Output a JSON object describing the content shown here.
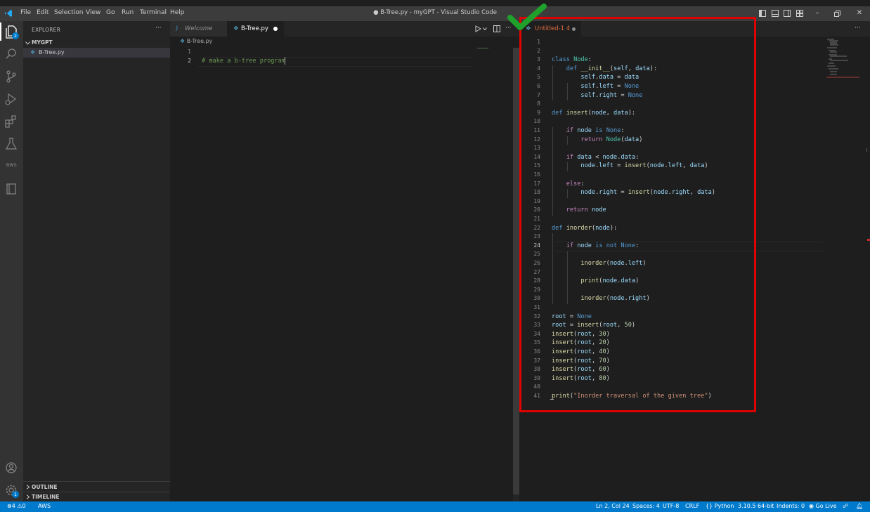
{
  "titlebar": {
    "menus": [
      "File",
      "Edit",
      "Selection",
      "View",
      "Go",
      "Run",
      "Terminal",
      "Help"
    ],
    "window_title": "● B-Tree.py - myGPT - Visual Studio Code"
  },
  "activitybar": {
    "explorer_badge": "2",
    "settings_badge": "1",
    "aws_label": "aws"
  },
  "sidebar": {
    "header": "EXPLORER",
    "more": "···",
    "folder": "MYGPT",
    "file": "B-Tree.py",
    "outline": "OUTLINE",
    "timeline": "TIMELINE"
  },
  "left_editor": {
    "tabs": [
      {
        "label": "Welcome"
      },
      {
        "label": "B-Tree.py"
      }
    ],
    "breadcrumb": "B-Tree.py",
    "lines": [
      "",
      "# make a b-tree program"
    ],
    "line_numbers": [
      "1",
      "2"
    ]
  },
  "right_editor": {
    "tab_label": "Untitled-1 4",
    "more": "···",
    "line_numbers": [
      "1",
      "2",
      "3",
      "4",
      "5",
      "6",
      "7",
      "8",
      "9",
      "10",
      "11",
      "12",
      "13",
      "14",
      "15",
      "16",
      "17",
      "18",
      "19",
      "20",
      "21",
      "22",
      "23",
      "24",
      "25",
      "26",
      "27",
      "28",
      "29",
      "30",
      "31",
      "32",
      "33",
      "34",
      "35",
      "36",
      "37",
      "38",
      "39",
      "40",
      "41"
    ],
    "lines": [
      "",
      "",
      "class Node:",
      "    def __init__(self, data):",
      "        self.data = data",
      "        self.left = None",
      "        self.right = None",
      "",
      "def insert(node, data):",
      "",
      "    if node is None:",
      "        return Node(data)",
      "",
      "    if data < node.data:",
      "        node.left = insert(node.left, data)",
      "",
      "    else:",
      "        node.right = insert(node.right, data)",
      "",
      "    return node",
      "",
      "def inorder(node):",
      "",
      "    if node is not None:",
      "",
      "        inorder(node.left)",
      "",
      "        print(node.data)",
      "",
      "        inorder(node.right)",
      "",
      "root = None",
      "root = insert(root, 50)",
      "insert(root, 30)",
      "insert(root, 20)",
      "insert(root, 40)",
      "insert(root, 70)",
      "insert(root, 60)",
      "insert(root, 80)",
      "",
      "print(\"Inorder traversal of the given tree\")"
    ]
  },
  "statusbar": {
    "errors": "4",
    "warnings": "0",
    "aws": "AWS",
    "position": "Ln 2, Col 24",
    "spaces": "Spaces: 4",
    "encoding": "UTF-8",
    "eol": "CRLF",
    "language": "Python",
    "interpreter": "3.10.5 64-bit",
    "indents": "Indents: 0",
    "golive": "Go Live"
  },
  "colors": {
    "accent": "#007acc",
    "highlight_box": "#e00000",
    "check": "#1fa12b"
  }
}
